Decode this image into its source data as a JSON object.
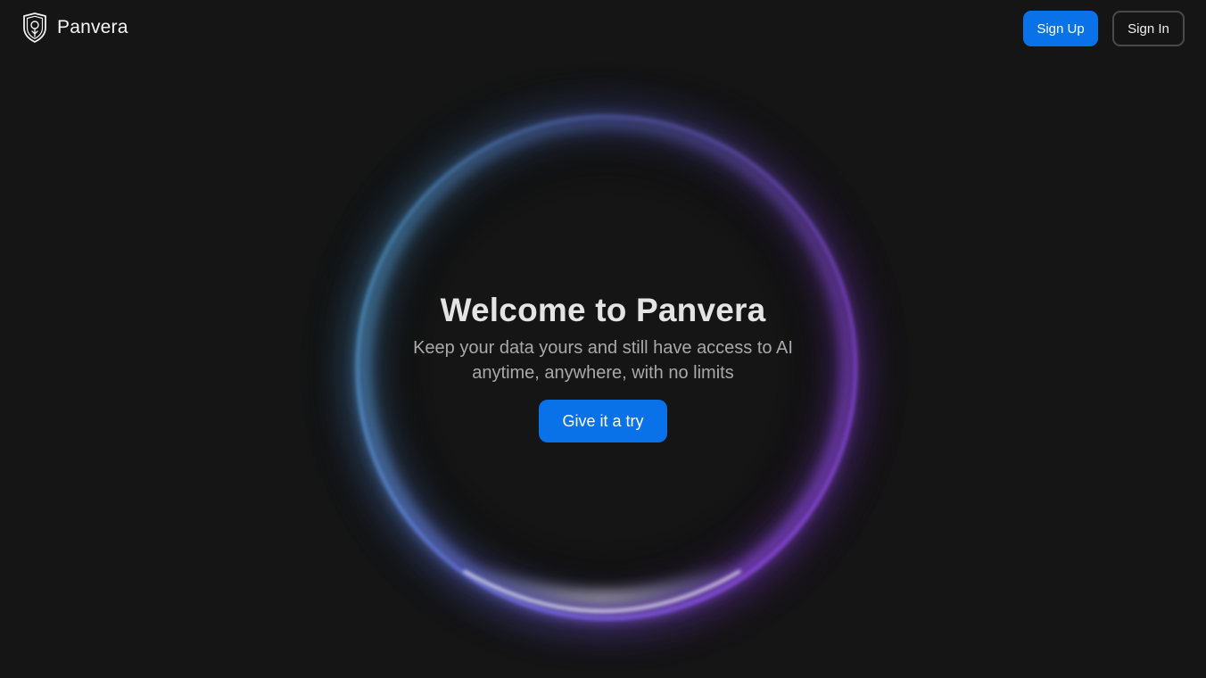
{
  "header": {
    "brand_name": "Panvera",
    "logo_icon": "shield-logo-icon",
    "signup_label": "Sign Up",
    "signin_label": "Sign In"
  },
  "hero": {
    "title": "Welcome to Panvera",
    "subtitle": "Keep your data yours and still have access to AI anytime, anywhere, with no limits",
    "cta_label": "Give it a try"
  },
  "colors": {
    "background": "#151515",
    "accent": "#0a72e8",
    "ring_left": "#4fb4e8",
    "ring_right": "#8a4bf0",
    "ring_bottom": "#ffffff"
  }
}
